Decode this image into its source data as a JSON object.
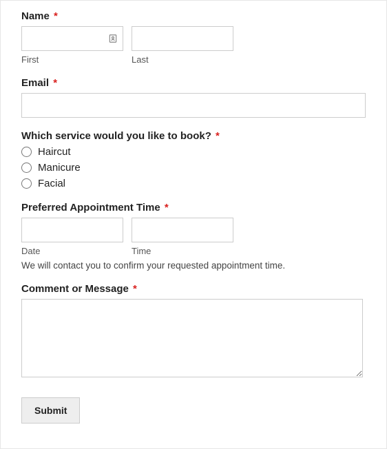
{
  "name": {
    "label": "Name",
    "first_sub": "First",
    "last_sub": "Last",
    "first_value": "",
    "last_value": ""
  },
  "email": {
    "label": "Email",
    "value": ""
  },
  "service": {
    "label": "Which service would you like to book?",
    "options": [
      "Haircut",
      "Manicure",
      "Facial"
    ]
  },
  "appointment": {
    "label": "Preferred Appointment Time",
    "date_sub": "Date",
    "time_sub": "Time",
    "date_value": "",
    "time_value": "",
    "description": "We will contact you to confirm your requested appointment time."
  },
  "comment": {
    "label": "Comment or Message",
    "value": ""
  },
  "submit_label": "Submit",
  "required_marker": "*"
}
